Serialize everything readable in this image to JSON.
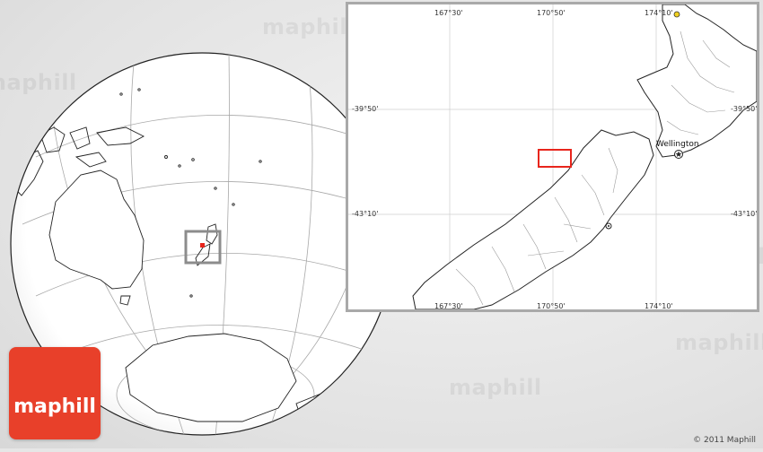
{
  "watermark": "maphill",
  "brand": {
    "name": "maphill",
    "color": "#e8402a"
  },
  "copyright": "© 2011 Maphill",
  "inset": {
    "top_coords": [
      "167°30'",
      "170°50'",
      "174°10'"
    ],
    "bottom_coords": [
      "167°30'",
      "170°50'",
      "174°10'"
    ],
    "left_coords": [
      "-39°50'",
      "-43°10'"
    ],
    "right_coords": [
      "-39°50'",
      "-43°10'"
    ],
    "city": {
      "name": "Wellington",
      "marker": "capital-star-icon"
    },
    "highlight_color": "#e8251c"
  },
  "globe": {
    "marker_color": "#e8251c",
    "frame_color": "#8c8c8c"
  }
}
